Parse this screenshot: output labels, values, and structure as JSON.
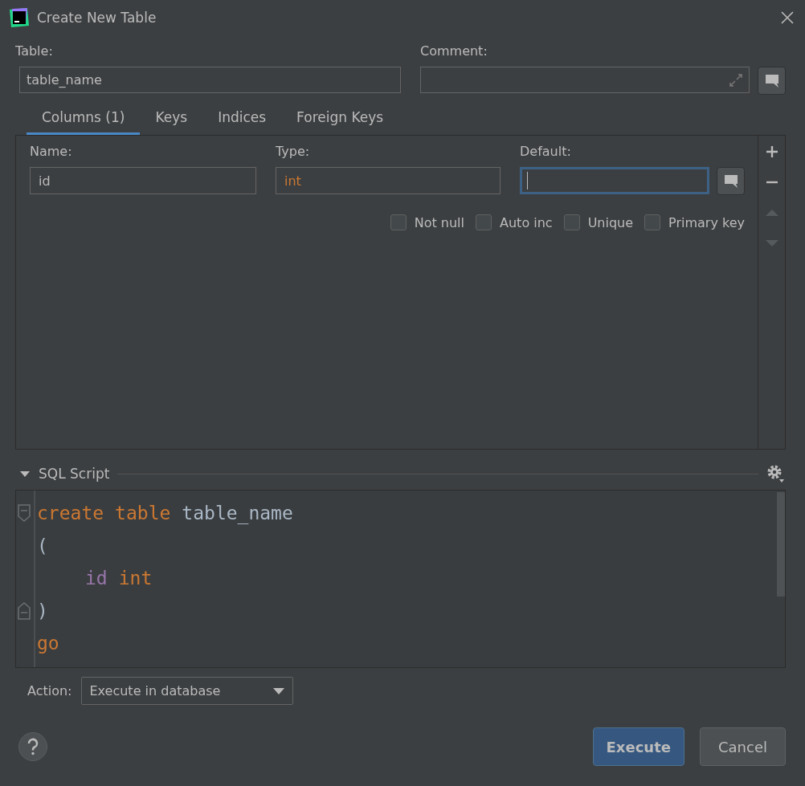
{
  "window": {
    "title": "Create New Table"
  },
  "table_field": {
    "label": "Table:",
    "value": "table_name"
  },
  "comment_field": {
    "label": "Comment:"
  },
  "tabs": [
    {
      "label": "Columns (1)",
      "selected": true
    },
    {
      "label": "Keys",
      "selected": false
    },
    {
      "label": "Indices",
      "selected": false
    },
    {
      "label": "Foreign Keys",
      "selected": false
    }
  ],
  "column_fields": [
    {
      "label": "Name:",
      "value": "id",
      "focused": false,
      "kind": "name"
    },
    {
      "label": "Type:",
      "value": "int",
      "focused": false,
      "kind": "type"
    },
    {
      "label": "Default:",
      "focused": true,
      "kind": "default"
    }
  ],
  "checkboxes": [
    {
      "label": "Not null",
      "checked": false
    },
    {
      "label": "Auto inc",
      "checked": false
    },
    {
      "label": "Unique",
      "checked": false
    },
    {
      "label": "Primary key",
      "checked": false
    }
  ],
  "sql_script": {
    "title": "SQL Script",
    "expanded": true,
    "lines": [
      {
        "fold_start": true,
        "indented": false,
        "tokens": [
          {
            "text": "create",
            "kind": "keyword"
          },
          {
            "text": "table",
            "kind": "keyword"
          },
          {
            "text": "table_name",
            "kind": "identifier"
          }
        ]
      },
      {
        "indented": false,
        "tokens": [
          {
            "text": "(",
            "kind": "punct"
          }
        ]
      },
      {
        "indented": true,
        "tokens": [
          {
            "text": "id",
            "kind": "column"
          },
          {
            "text": "int",
            "kind": "keyword"
          }
        ]
      },
      {
        "fold_end": true,
        "indented": false,
        "tokens": [
          {
            "text": ")",
            "kind": "punct"
          }
        ]
      },
      {
        "indented": false,
        "tokens": [
          {
            "text": "go",
            "kind": "keyword"
          }
        ]
      }
    ]
  },
  "action": {
    "label": "Action:",
    "value": "Execute in database"
  },
  "buttons": [
    {
      "label": "Execute",
      "kind": "primary"
    },
    {
      "label": "Cancel",
      "kind": "secondary"
    }
  ]
}
